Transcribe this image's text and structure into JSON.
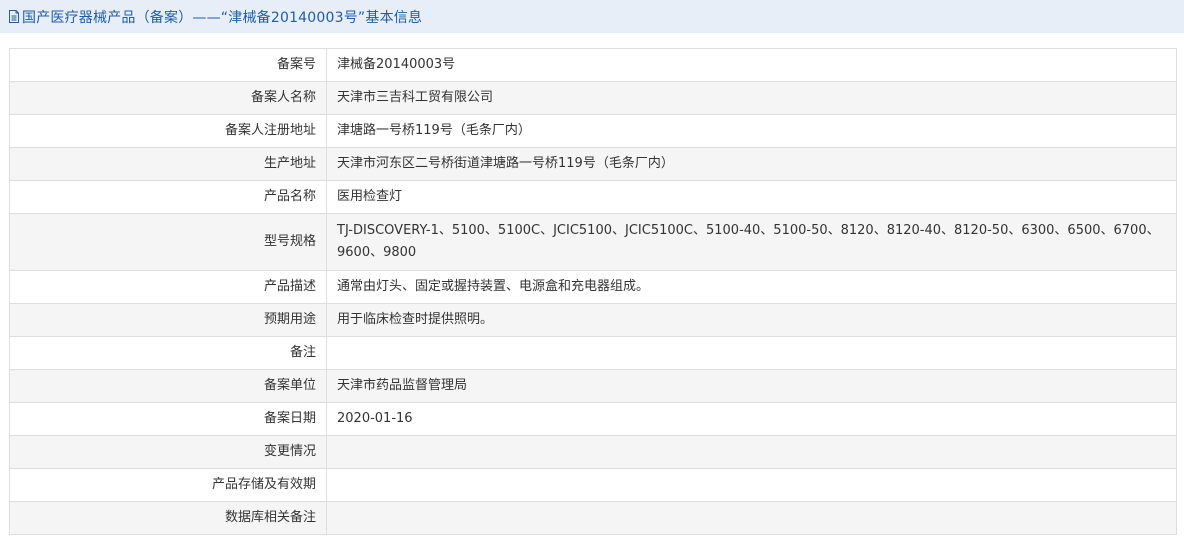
{
  "header": {
    "icon": "document-icon",
    "title": "国产医疗器械产品（备案）——“津械备20140003号”基本信息",
    "color": "#1f5da8",
    "background": "#e7eef8"
  },
  "rows": [
    {
      "label": "备案号",
      "value": "津械备20140003号"
    },
    {
      "label": "备案人名称",
      "value": "天津市三吉科工贸有限公司"
    },
    {
      "label": "备案人注册地址",
      "value": "津塘路一号桥119号（毛条厂内）"
    },
    {
      "label": "生产地址",
      "value": "天津市河东区二号桥街道津塘路一号桥119号（毛条厂内）"
    },
    {
      "label": "产品名称",
      "value": "医用检查灯"
    },
    {
      "label": "型号规格",
      "value": "TJ-DISCOVERY-1、5100、5100C、JCIC5100、JCIC5100C、5100-40、5100-50、8120、8120-40、8120-50、6300、6500、6700、9600、9800"
    },
    {
      "label": "产品描述",
      "value": "通常由灯头、固定或握持装置、电源盒和充电器组成。"
    },
    {
      "label": "预期用途",
      "value": "用于临床检查时提供照明。"
    },
    {
      "label": "备注",
      "value": ""
    },
    {
      "label": "备案单位",
      "value": "天津市药品监督管理局"
    },
    {
      "label": "备案日期",
      "value": "2020-01-16"
    },
    {
      "label": "变更情况",
      "value": ""
    },
    {
      "label": "产品存储及有效期",
      "value": ""
    },
    {
      "label": "数据库相关备注",
      "value": ""
    }
  ]
}
